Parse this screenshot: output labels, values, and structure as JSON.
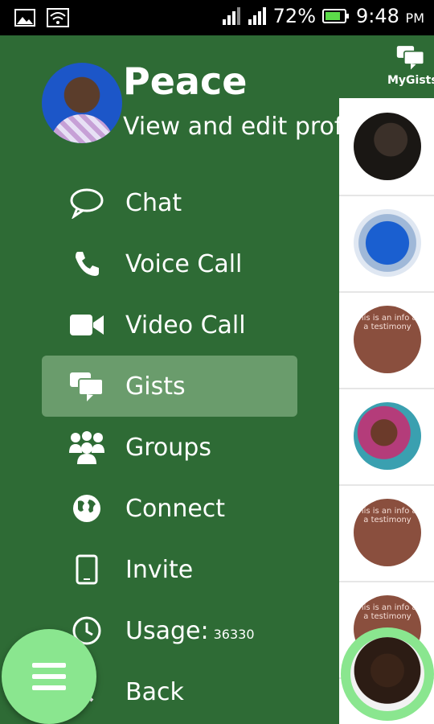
{
  "status_bar": {
    "battery": "72%",
    "time": "9:48",
    "ampm": "PM",
    "icons": [
      "image-icon",
      "wifi-icon",
      "signal-icon",
      "signal-icon",
      "battery-icon"
    ]
  },
  "drawer": {
    "profile": {
      "name": "Peace",
      "subtitle": "View and edit profile"
    },
    "items": [
      {
        "label": "Chat",
        "icon": "chat-bubble-icon"
      },
      {
        "label": "Voice Call",
        "icon": "phone-icon"
      },
      {
        "label": "Video Call",
        "icon": "video-camera-icon"
      },
      {
        "label": "Gists",
        "icon": "gists-icon",
        "active": true
      },
      {
        "label": "Groups",
        "icon": "groups-icon"
      },
      {
        "label": "Connect",
        "icon": "globe-icon"
      },
      {
        "label": "Invite",
        "icon": "phone-device-icon"
      },
      {
        "label": "Usage:",
        "value": "36330",
        "icon": "clock-icon"
      },
      {
        "label": "Back",
        "icon": "back-icon"
      }
    ]
  },
  "content": {
    "mygists_label": "MyGists",
    "list": [
      {
        "type": "photo"
      },
      {
        "type": "logo"
      },
      {
        "type": "info",
        "text": "This is an info as a testimony"
      },
      {
        "type": "photo"
      },
      {
        "type": "info",
        "text": "This is an info as a testimony"
      },
      {
        "type": "info",
        "text": "This is an info as a testimony"
      }
    ]
  },
  "colors": {
    "drawer_bg": "#2e6b35",
    "active_item": "#6a9c6c",
    "fab": "#8ae68f",
    "info_thumb": "#8a4f3e"
  }
}
